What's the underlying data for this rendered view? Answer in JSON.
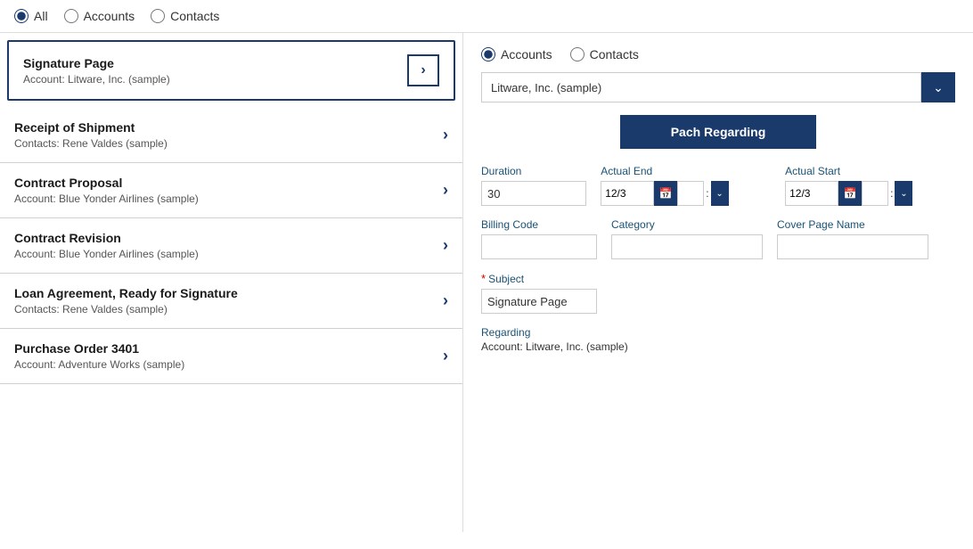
{
  "topBar": {
    "radioGroup": {
      "options": [
        {
          "id": "all",
          "label": "All",
          "checked": true
        },
        {
          "id": "accounts",
          "label": "Accounts",
          "checked": false
        },
        {
          "id": "contacts",
          "label": "Contacts",
          "checked": false
        }
      ]
    }
  },
  "leftPanel": {
    "items": [
      {
        "title": "Signature Page",
        "sub": "Account: Litware, Inc. (sample)",
        "selected": true
      },
      {
        "title": "Receipt of Shipment",
        "sub": "Contacts: Rene Valdes (sample)",
        "selected": false
      },
      {
        "title": "Contract Proposal",
        "sub": "Account: Blue Yonder Airlines (sample)",
        "selected": false
      },
      {
        "title": "Contract Revision",
        "sub": "Account: Blue Yonder Airlines (sample)",
        "selected": false
      },
      {
        "title": "Loan Agreement, Ready for Signature",
        "sub": "Contacts: Rene Valdes (sample)",
        "selected": false
      },
      {
        "title": "Purchase Order 3401",
        "sub": "Account: Adventure Works (sample)",
        "selected": false
      }
    ]
  },
  "rightPanel": {
    "radioGroup": {
      "options": [
        {
          "id": "r-accounts",
          "label": "Accounts",
          "checked": true
        },
        {
          "id": "r-contacts",
          "label": "Contacts",
          "checked": false
        }
      ]
    },
    "dropdown": {
      "value": "Litware, Inc. (sample)",
      "placeholder": "Litware, Inc. (sample)"
    },
    "patchButton": "Pach Regarding",
    "fields": {
      "durationLabel": "Duration",
      "durationValue": "30",
      "actualEndLabel": "Actual End",
      "actualEndDate": "12/3",
      "actualStartLabel": "Actual Start",
      "actualStartDate": "12/3",
      "billingCodeLabel": "Billing Code",
      "billingCodeValue": "",
      "categoryLabel": "Category",
      "categoryValue": "",
      "coverPageNameLabel": "Cover Page Name",
      "coverPageNameValue": "",
      "subjectLabel": "Subject",
      "subjectValue": "Signature Page",
      "regardingLabel": "Regarding",
      "regardingValue": "Account: Litware, Inc. (sample)"
    }
  }
}
